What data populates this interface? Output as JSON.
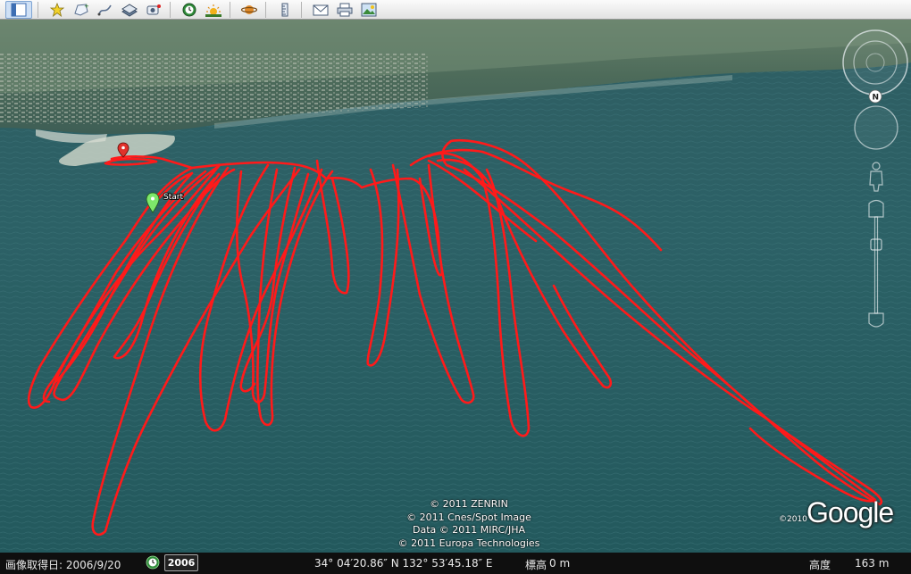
{
  "toolbar": {
    "buttons": [
      {
        "name": "sidebar-toggle-button",
        "icon": "sidebar-icon"
      },
      {
        "name": "add-placemark-button",
        "icon": "pushpin-icon"
      },
      {
        "name": "add-polygon-button",
        "icon": "polygon-icon"
      },
      {
        "name": "add-path-button",
        "icon": "path-icon"
      },
      {
        "name": "add-overlay-button",
        "icon": "overlay-icon"
      },
      {
        "name": "record-tour-button",
        "icon": "record-tour-icon"
      },
      {
        "name": "historical-imagery-button",
        "icon": "clock-icon"
      },
      {
        "name": "sunlight-button",
        "icon": "sun-icon"
      },
      {
        "name": "switch-planet-button",
        "icon": "planet-icon"
      },
      {
        "name": "ruler-button",
        "icon": "ruler-icon"
      },
      {
        "name": "email-button",
        "icon": "email-icon"
      },
      {
        "name": "print-button",
        "icon": "print-icon"
      },
      {
        "name": "save-image-button",
        "icon": "save-image-icon"
      }
    ]
  },
  "map": {
    "start_label": "Start",
    "track_color": "#ff1a1a",
    "start_pin_color": "#7de86a",
    "end_pin_color": "#e0322b"
  },
  "nav": {
    "compass_label": "N"
  },
  "attribution": {
    "lines": [
      "© 2011 ZENRIN",
      "© 2011 Cnes/Spot Image",
      "Data © 2011 MIRC/JHA",
      "© 2011 Europa Technologies"
    ],
    "logo_year": "©2010",
    "logo_text": "Google"
  },
  "statusbar": {
    "imagery_date": "画像取得日: 2006/9/20",
    "history_year": "2006",
    "coordinates": "34° 04′20.86″ N 132° 53′45.18″ E",
    "elevation_label": "標高",
    "elevation_value": "0 m",
    "altitude_label": "高度",
    "altitude_value": "163 m"
  }
}
